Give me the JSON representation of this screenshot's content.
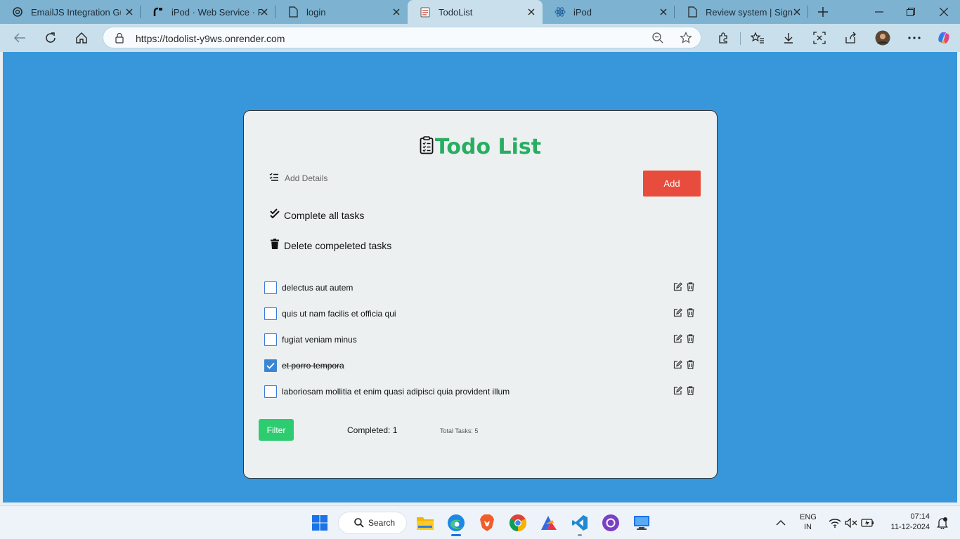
{
  "browser": {
    "tabs": [
      {
        "title": "EmailJS Integration Guid",
        "icon": "openai-icon"
      },
      {
        "title": "iPod · Web Service · Re",
        "icon": "render-icon"
      },
      {
        "title": "login",
        "icon": "page-icon"
      },
      {
        "title": "TodoList",
        "icon": "notepad-icon",
        "active": true
      },
      {
        "title": "iPod",
        "icon": "react-icon"
      },
      {
        "title": "Review system | Sign In",
        "icon": "page-icon"
      }
    ],
    "url": "https://todolist-y9ws.onrender.com"
  },
  "app": {
    "title": "Todo List",
    "input_placeholder": "Add Details",
    "add_label": "Add",
    "complete_all_label": "Complete all tasks",
    "delete_completed_label": "Delete compeleted tasks",
    "tasks": [
      {
        "text": "delectus aut autem",
        "completed": false
      },
      {
        "text": "quis ut nam facilis et officia qui",
        "completed": false
      },
      {
        "text": "fugiat veniam minus",
        "completed": false
      },
      {
        "text": "et porro tempora",
        "completed": true
      },
      {
        "text": "laboriosam mollitia et enim quasi adipisci quia provident illum",
        "completed": false
      }
    ],
    "filter_label": "Filter",
    "completed_text": "Completed: 1",
    "total_text": "Total Tasks: 5"
  },
  "taskbar": {
    "search_label": "Search",
    "lang_line1": "ENG",
    "lang_line2": "IN",
    "time": "07:14",
    "date": "11-12-2024"
  },
  "colors": {
    "page_bg": "#3897db",
    "card_bg": "#ecf0f1",
    "title_green": "#27ae60",
    "add_red": "#e74c3c",
    "filter_green": "#2ecc71",
    "checkbox_blue": "#3a86d5"
  }
}
